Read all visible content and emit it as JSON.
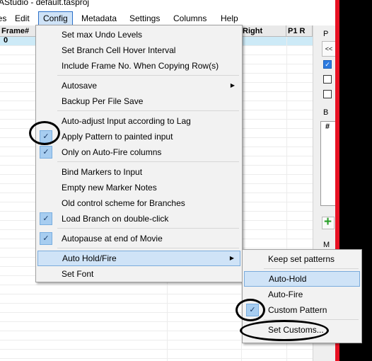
{
  "window": {
    "title_fragment": "AStudio - default.tasproj"
  },
  "menubar": [
    {
      "label": "ies"
    },
    {
      "label": "Edit"
    },
    {
      "label": "Config"
    },
    {
      "label": "Metadata"
    },
    {
      "label": "Settings"
    },
    {
      "label": "Columns"
    },
    {
      "label": "Help"
    }
  ],
  "grid": {
    "headers": [
      "Frame#",
      "Right",
      "P1 R"
    ],
    "first_row_value": "0"
  },
  "right_panel": {
    "labels": [
      "P",
      "<<",
      "B",
      "#",
      "M"
    ]
  },
  "config_menu": {
    "items": {
      "undo": "Set max Undo Levels",
      "hover": "Set Branch Cell Hover Interval",
      "include_frame": "Include Frame No. When Copying Row(s)",
      "autosave": "Autosave",
      "backup": "Backup Per File Save",
      "auto_adjust": "Auto-adjust Input according to Lag",
      "apply_pattern": "Apply Pattern to painted input",
      "only_autofire": "Only on Auto-Fire columns",
      "bind_markers": "Bind Markers to Input",
      "empty_notes": "Empty new Marker Notes",
      "old_control": "Old control scheme for Branches",
      "load_branch": "Load Branch on double-click",
      "autopause": "Autopause at end of Movie",
      "auto_hold_fire": "Auto Hold/Fire",
      "set_font": "Set Font"
    }
  },
  "submenu": {
    "items": {
      "keep": "Keep set patterns",
      "auto_hold": "Auto-Hold",
      "auto_fire": "Auto-Fire",
      "custom_pattern": "Custom Pattern",
      "set_customs": "Set Customs..."
    }
  },
  "glyphs": {
    "check": "✓",
    "arrow": "▶",
    "plus": "+"
  },
  "colors": {
    "highlight": "#cfe3f7",
    "check_bg": "#a7cdf0",
    "red_bar": "#e81123"
  }
}
